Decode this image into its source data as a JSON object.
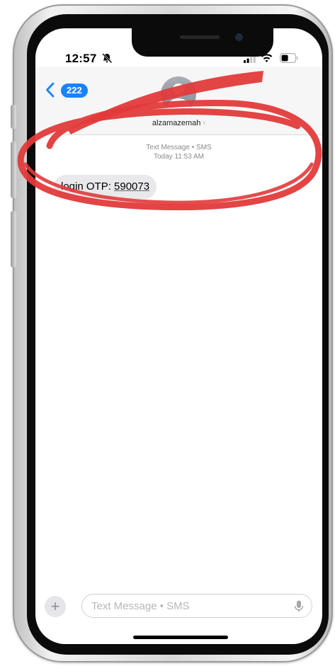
{
  "status_bar": {
    "time": "12:57",
    "icons": [
      "bell-slash-icon",
      "signal-icon",
      "wifi-icon",
      "battery-icon"
    ]
  },
  "header": {
    "back_badge": "222",
    "contact_name": "alzamazemah",
    "contact_chevron": "›"
  },
  "thread": {
    "meta_line1": "Text Message • SMS",
    "meta_line2": "Today 11:53 AM",
    "messages": [
      {
        "prefix": "login OTP: ",
        "code": "590073"
      }
    ]
  },
  "compose": {
    "plus_label": "+",
    "placeholder": "Text Message • SMS"
  },
  "colors": {
    "accent_blue": "#1a82fb",
    "bubble_gray": "#e9e9eb",
    "annotation_red": "#e23a3a"
  }
}
